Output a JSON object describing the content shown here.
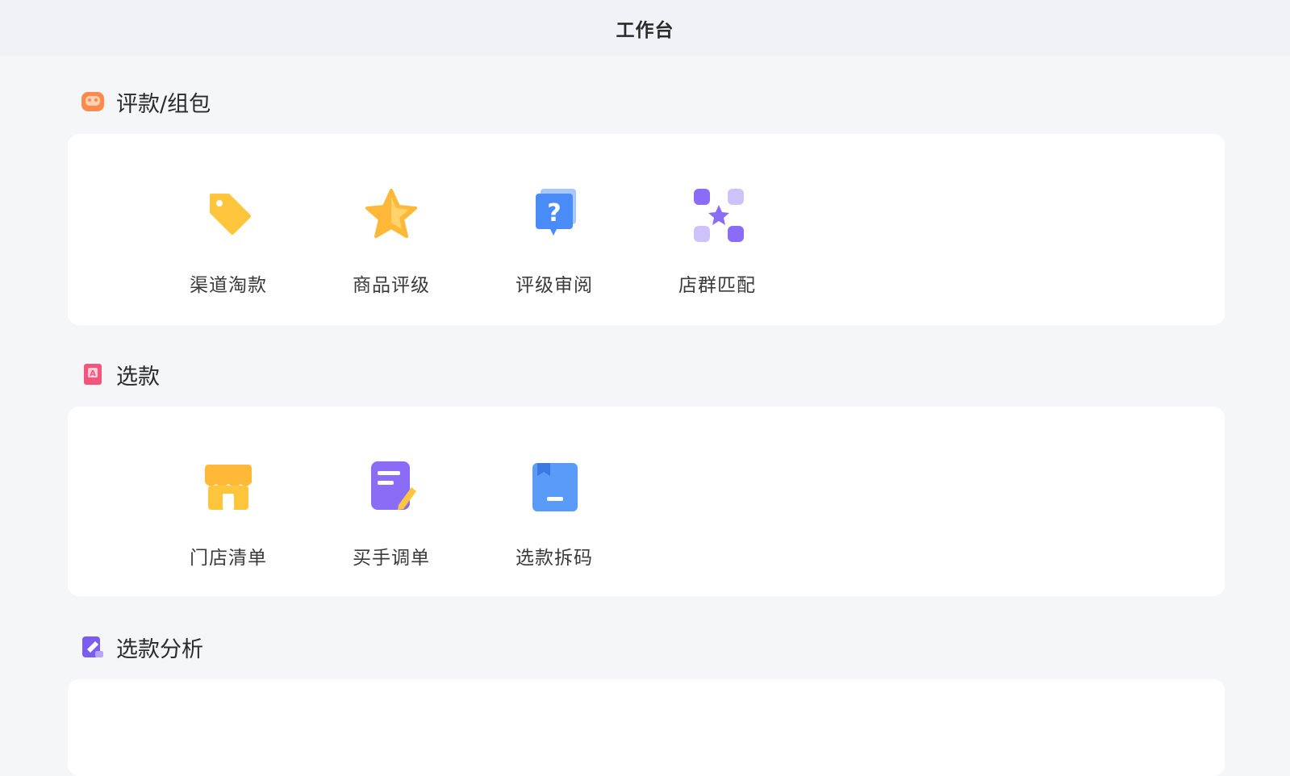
{
  "header": {
    "title": "工作台"
  },
  "sections": [
    {
      "title": "评款/组包",
      "icon": "palette-icon",
      "items": [
        {
          "label": "渠道淘款",
          "icon": "tag-icon"
        },
        {
          "label": "商品评级",
          "icon": "star-icon"
        },
        {
          "label": "评级审阅",
          "icon": "question-icon"
        },
        {
          "label": "店群匹配",
          "icon": "network-icon"
        }
      ]
    },
    {
      "title": "选款",
      "icon": "bookmark-icon",
      "items": [
        {
          "label": "门店清单",
          "icon": "store-icon"
        },
        {
          "label": "买手调单",
          "icon": "edit-note-icon"
        },
        {
          "label": "选款拆码",
          "icon": "folder-icon"
        }
      ]
    },
    {
      "title": "选款分析",
      "icon": "analysis-icon",
      "items": []
    }
  ],
  "colors": {
    "background": "#f5f6f8",
    "card": "#ffffff",
    "yellow": "#ffc53d",
    "blue": "#4a8cf7",
    "purple": "#8b6cf6",
    "pink": "#f5557a",
    "orange": "#ff8a4c"
  }
}
